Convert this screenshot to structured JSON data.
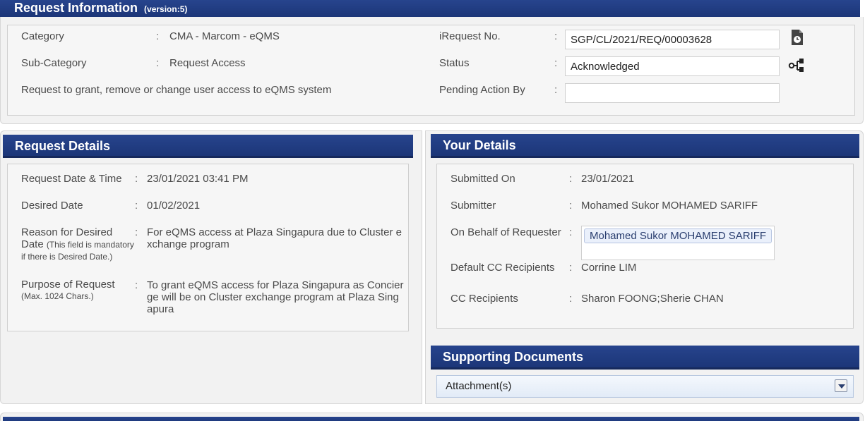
{
  "request_info": {
    "title": "Request Information",
    "version": "(version:5)",
    "category_label": "Category",
    "category_value": "CMA - Marcom - eQMS",
    "subcategory_label": "Sub-Category",
    "subcategory_value": "Request Access",
    "description": "Request to grant, remove or change user access to eQMS system",
    "irequest_label": "iRequest No.",
    "irequest_value": "SGP/CL/2021/REQ/00003628",
    "status_label": "Status",
    "status_value": "Acknowledged",
    "pending_label": "Pending Action By",
    "pending_value": ""
  },
  "request_details": {
    "title": "Request Details",
    "datetime_label": "Request Date & Time",
    "datetime_value": "23/01/2021 03:41 PM",
    "desired_label": "Desired Date",
    "desired_value": "01/02/2021",
    "reason_label": "Reason for Desired Date",
    "reason_note": "(This field is mandatory if there is Desired Date.)",
    "reason_value": "For eQMS access at Plaza Singapura due to Cluster exchange program",
    "purpose_label": "Purpose of Request",
    "purpose_note": "(Max. 1024 Chars.)",
    "purpose_value": "To grant eQMS access for Plaza Singapura as Concierge will be on Cluster exchange program at Plaza Singapura"
  },
  "your_details": {
    "title": "Your Details",
    "submitted_label": "Submitted On",
    "submitted_value": "23/01/2021",
    "submitter_label": "Submitter",
    "submitter_value": "Mohamed Sukor MOHAMED SARIFF",
    "behalf_label": "On Behalf of Requester",
    "behalf_value": "Mohamed Sukor MOHAMED SARIFF",
    "default_cc_label": "Default CC Recipients",
    "default_cc_value": "Corrine LIM",
    "cc_label": "CC Recipients",
    "cc_value": "Sharon FOONG;Sherie CHAN"
  },
  "supporting_docs": {
    "title": "Supporting Documents",
    "attachments_label": "Attachment(s)"
  },
  "icons": {
    "document": "document-clock-icon",
    "workflow": "workflow-icon",
    "dropdown": "chevron-down-icon"
  },
  "colors": {
    "header": "#1f3a80",
    "header_border": "#16295c"
  }
}
